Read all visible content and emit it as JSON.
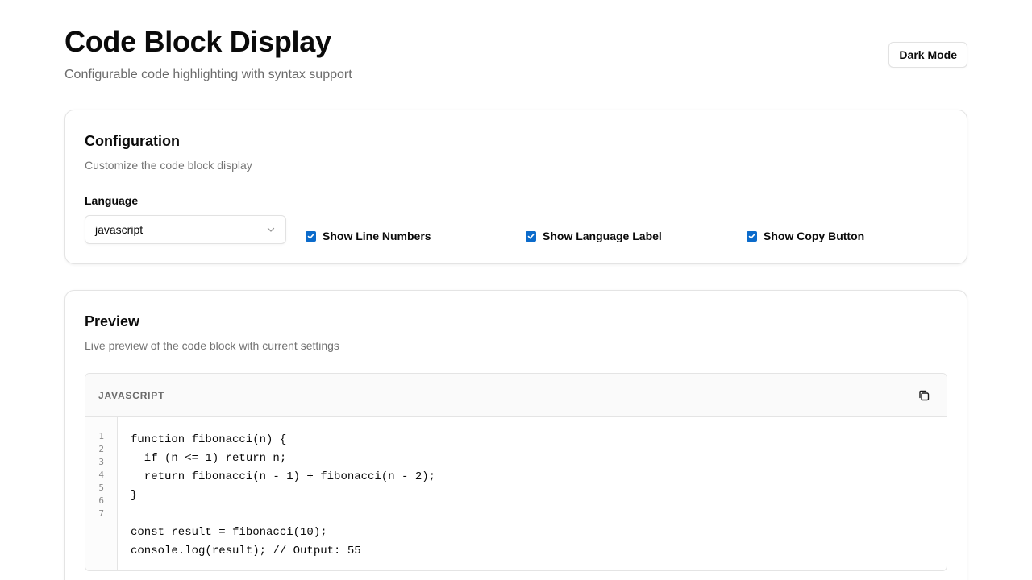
{
  "header": {
    "title": "Code Block Display",
    "subtitle": "Configurable code highlighting with syntax support",
    "dark_mode_label": "Dark Mode"
  },
  "config": {
    "title": "Configuration",
    "description": "Customize the code block display",
    "language_label": "Language",
    "language_value": "javascript",
    "options": [
      {
        "label": "Show Line Numbers",
        "checked": true
      },
      {
        "label": "Show Language Label",
        "checked": true
      },
      {
        "label": "Show Copy Button",
        "checked": true
      }
    ]
  },
  "preview": {
    "title": "Preview",
    "description": "Live preview of the code block with current settings",
    "language_label": "JAVASCRIPT",
    "copy_icon": "copy-icon",
    "line_numbers": [
      "1",
      "2",
      "3",
      "4",
      "5",
      "6",
      "7"
    ],
    "code_lines": [
      "function fibonacci(n) {",
      "  if (n <= 1) return n;",
      "  return fibonacci(n - 1) + fibonacci(n - 2);",
      "}",
      "",
      "const result = fibonacci(10);",
      "console.log(result); // Output: 55"
    ]
  },
  "colors": {
    "checkbox_accent": "#0b6bcb",
    "muted_text": "#6b6b6b",
    "border": "#e4e4e4"
  }
}
